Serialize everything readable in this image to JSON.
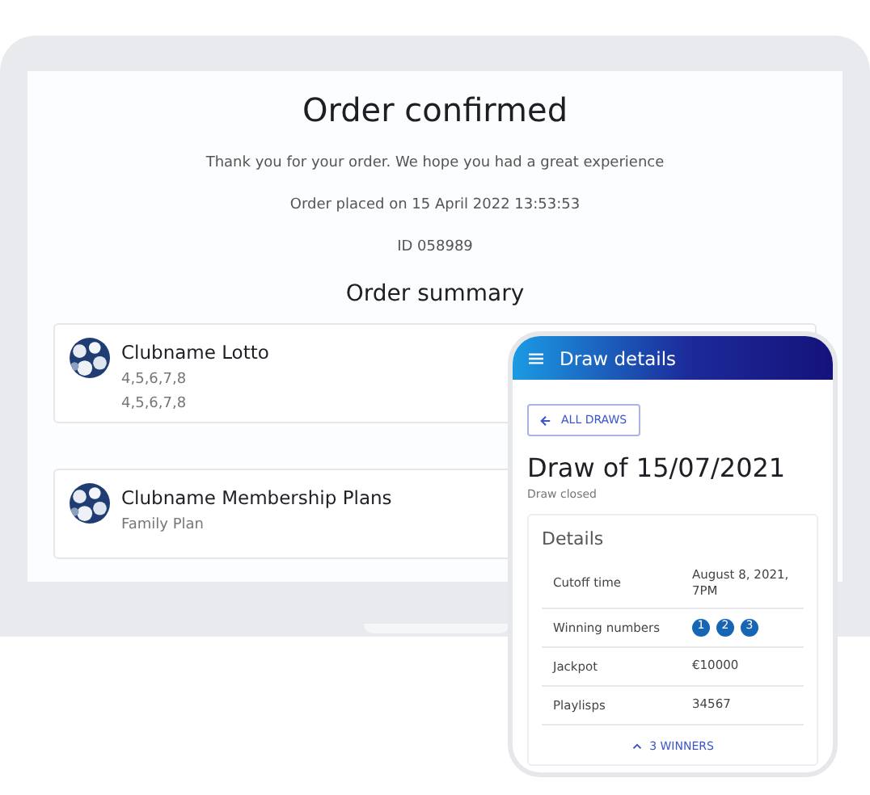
{
  "order_page": {
    "title": "Order confirmed",
    "message": "Thank you for your order. We hope you had a great experience",
    "placed": "Order placed on 15 April 2022 13:53:53",
    "order_id": "ID 058989",
    "summary_heading": "Order summary",
    "items": [
      {
        "name": "Clubname Lotto",
        "lines": [
          "4,5,6,7,8",
          "4,5,6,7,8"
        ]
      },
      {
        "name": "Clubname Membership Plans",
        "lines": [
          "Family Plan"
        ]
      }
    ]
  },
  "phone": {
    "header": "Draw details",
    "back_button": "ALL DRAWS",
    "title": "Draw of 15/07/2021",
    "status": "Draw closed",
    "details_heading": "Details",
    "rows": [
      {
        "kind": "text",
        "label": "Cutoff time",
        "value": "August 8, 2021, 7PM"
      },
      {
        "kind": "balls",
        "label": "Winning numbers",
        "balls": [
          "1",
          "2",
          "3"
        ]
      },
      {
        "kind": "text",
        "label": "Jackpot",
        "value": "€10000"
      },
      {
        "kind": "text",
        "label": "Playlisps",
        "value": "34567"
      }
    ],
    "winners_toggle": "3 WINNERS"
  }
}
